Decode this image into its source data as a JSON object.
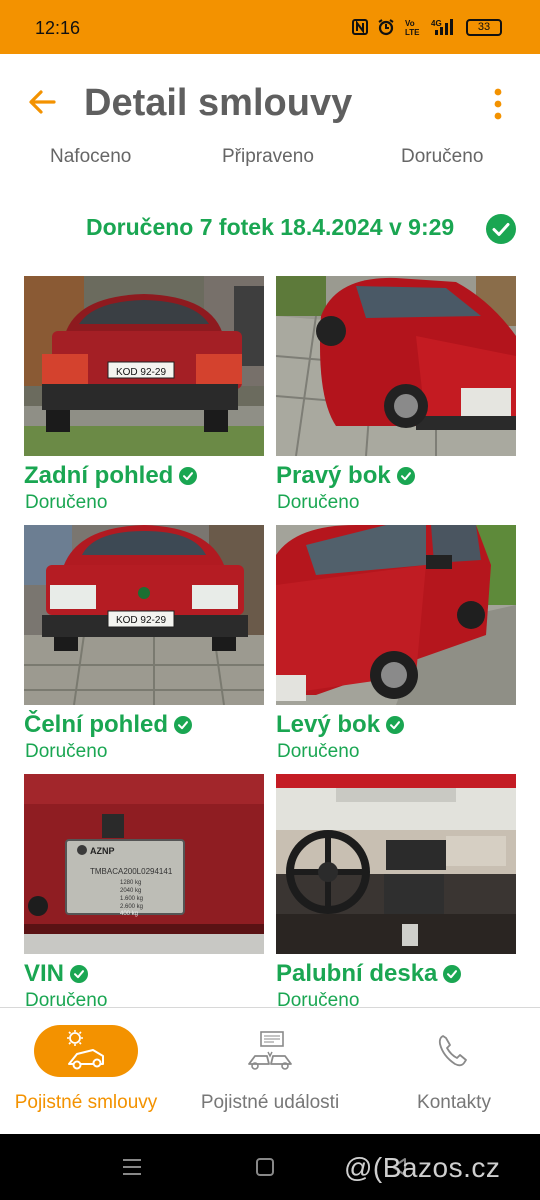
{
  "status_bar": {
    "time": "12:16",
    "battery": "33",
    "icons": [
      "nfc-icon",
      "alarm-icon",
      "volte-icon",
      "signal-4g-icon",
      "battery-icon"
    ]
  },
  "header": {
    "title": "Detail smlouvy",
    "back_icon": "arrow-left-icon",
    "menu_icon": "more-vertical-icon"
  },
  "steps": [
    "Nafoceno",
    "Připraveno",
    "Doručeno"
  ],
  "delivered_banner": "Doručeno 7 fotek 18.4.2024 v 9:29",
  "photos": [
    {
      "title": "Zadní pohled",
      "status": "Doručeno"
    },
    {
      "title": "Pravý bok",
      "status": "Doručeno"
    },
    {
      "title": "Čelní pohled",
      "status": "Doručeno"
    },
    {
      "title": "Levý bok",
      "status": "Doručeno"
    },
    {
      "title": "VIN",
      "status": "Doručeno"
    },
    {
      "title": "Palubní deska",
      "status": "Doručeno"
    }
  ],
  "photo_text": {
    "plate_rear": "KOD 92-29",
    "plate_front": "KOD 92-29",
    "vin_plate": [
      "AZNP",
      "TMBACA200L0294141",
      "1280 kg",
      "2040 kg",
      "1.600 kg",
      "2.600 kg",
      "400 kg"
    ]
  },
  "bottom_nav": [
    {
      "label": "Pojistné smlouvy",
      "icon": "car-insurance-icon",
      "active": true
    },
    {
      "label": "Pojistné události",
      "icon": "car-accident-icon",
      "active": false
    },
    {
      "label": "Kontakty",
      "icon": "phone-icon",
      "active": false
    }
  ],
  "watermark": "@(Bazos.cz",
  "colors": {
    "accent": "#f39200",
    "success": "#1aa652",
    "title_gray": "#5f5f5f"
  }
}
